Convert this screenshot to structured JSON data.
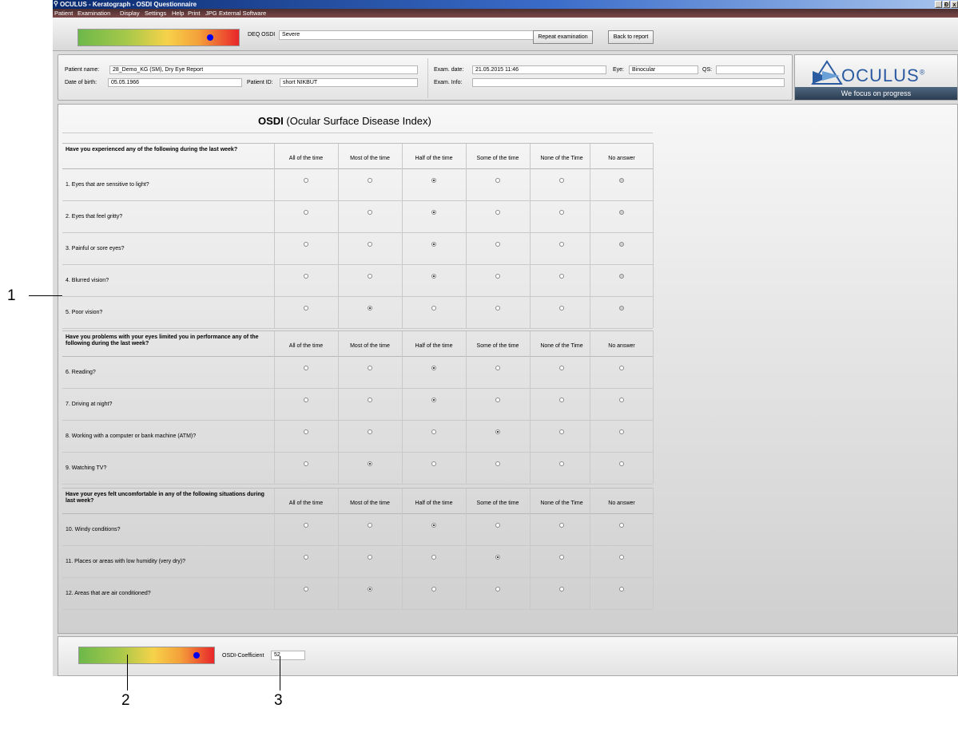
{
  "window": {
    "title": "OCULUS - Keratograph - OSDI Questionnaire",
    "controls": [
      "_",
      "Ɖ",
      "x"
    ]
  },
  "menu": [
    "Patient",
    "Examination",
    "Display",
    "Settings",
    "Help",
    "Print",
    "JPG",
    "External Software"
  ],
  "toolbar": {
    "questionnaire_label": "DEQ OSDI",
    "severity_value": "Severe",
    "repeat_button": "Repeat examination",
    "back_button": "Back to report",
    "scale_marker": 0.82
  },
  "patient": {
    "name_label": "Patient name:",
    "name_value": "28_Demo_KG (SM), Dry Eye Report",
    "dob_label": "Date of birth:",
    "dob_value": "05.05.1966",
    "id_label": "Patient ID:",
    "id_value": "short NIKBUT",
    "exam_date_label": "Exam. date:",
    "exam_date_value": "21.05.2015 11:46",
    "eye_label": "Eye:",
    "eye_value": "Binocular",
    "qs_label": "QS:",
    "qs_value": "",
    "exam_info_label": "Exam. Info:",
    "exam_info_value": ""
  },
  "logo": {
    "brand": "OCULUS",
    "tagline": "We focus on progress",
    "registered": "®"
  },
  "osdi": {
    "title_bold": "OSDI",
    "title_rest": "(Ocular Surface Disease Index)",
    "columns": [
      "All of the time",
      "Most of the time",
      "Half of the time",
      "Some of the time",
      "None of the Time",
      "No answer"
    ],
    "sections": [
      {
        "question": "Have you experienced any of the following during the last week?",
        "items": [
          {
            "text": "1. Eyes that are sensitive to light?",
            "selected": 2
          },
          {
            "text": "2. Eyes that feel gritty?",
            "selected": 2
          },
          {
            "text": "3. Painful or sore eyes?",
            "selected": 2
          },
          {
            "text": "4. Blurred vision?",
            "selected": 2
          },
          {
            "text": "5. Poor vision?",
            "selected": 1
          }
        ]
      },
      {
        "question": "Have you problems with your eyes limited you in performance any of the following during the last week?",
        "items": [
          {
            "text": "6. Reading?",
            "selected": 2
          },
          {
            "text": "7. Driving at night?",
            "selected": 2
          },
          {
            "text": "8. Working with a computer or bank machine (ATM)?",
            "selected": 3
          },
          {
            "text": "9. Watching TV?",
            "selected": 1
          }
        ]
      },
      {
        "question": "Have your eyes felt uncomfortable in any of the following situations during last week?",
        "items": [
          {
            "text": "10. Windy conditions?",
            "selected": 2
          },
          {
            "text": "11. Places or areas with low humidity (very dry)?",
            "selected": 3
          },
          {
            "text": "12. Areas that are air conditioned?",
            "selected": 1
          }
        ]
      }
    ]
  },
  "footer": {
    "coefficient_label": "OSDI-Coefficient",
    "coefficient_value": "52",
    "scale_marker": 0.87
  },
  "callouts": [
    "1",
    "2",
    "3"
  ]
}
